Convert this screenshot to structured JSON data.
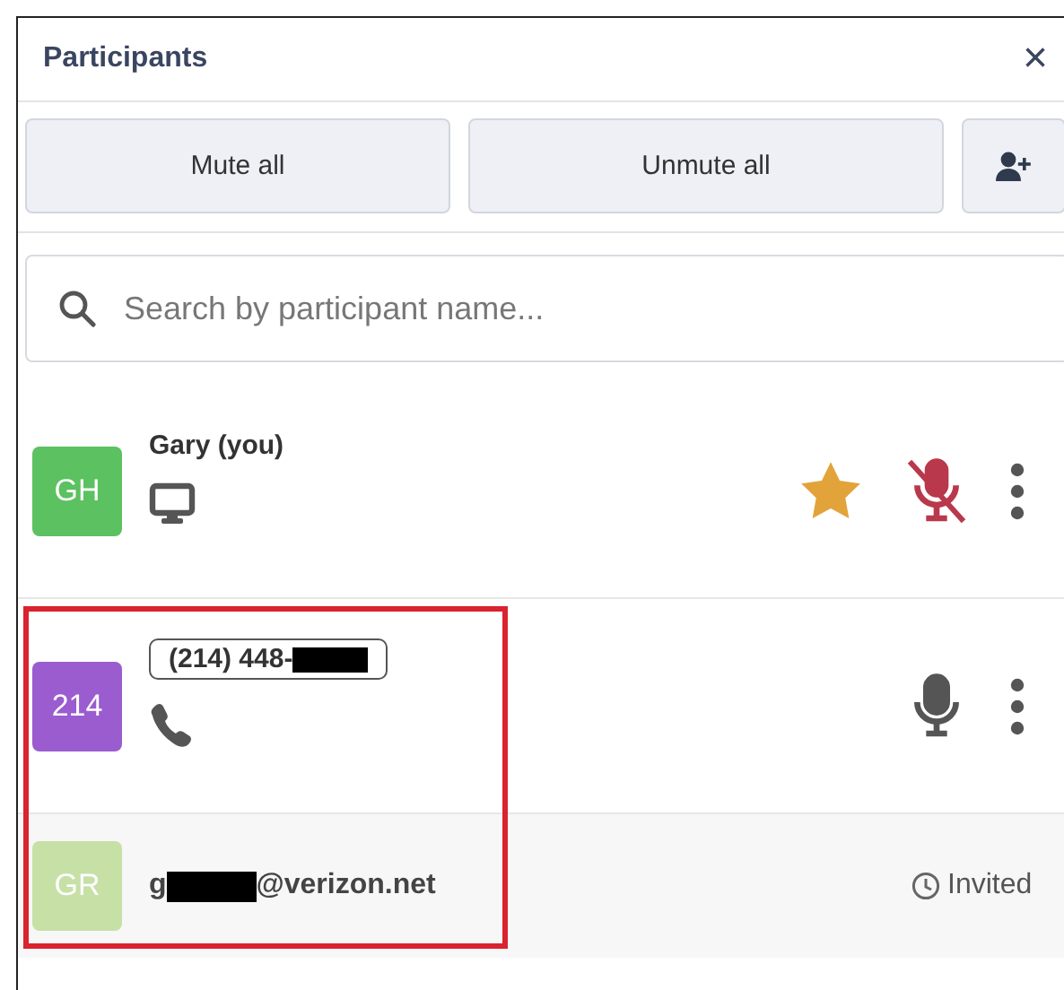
{
  "panel": {
    "title": "Participants",
    "close": "×"
  },
  "actions": [
    {
      "kind": "text",
      "label": "Mute all"
    },
    {
      "kind": "text",
      "label": "Unmute all"
    },
    {
      "kind": "add-person"
    }
  ],
  "search": {
    "placeholder": "Search by participant name..."
  },
  "participants": [
    {
      "kind": "joined",
      "initials": "GH",
      "color": "#5cc160",
      "outlined": false,
      "name": [
        {
          "kind": "text",
          "text": "Gary (you)"
        }
      ],
      "device": {
        "kind": "computer"
      },
      "starred": true,
      "muted": true
    },
    {
      "kind": "joined",
      "initials": "214",
      "color": "#9a5ccf",
      "outlined": true,
      "name": [
        {
          "kind": "text",
          "text": "(214) 448-"
        },
        {
          "kind": "redaction"
        }
      ],
      "device": {
        "kind": "phone"
      },
      "starred": false,
      "muted": false
    },
    {
      "kind": "invited",
      "initials": "GR",
      "color": "#c6e0a6",
      "name": [
        {
          "kind": "text",
          "text": "g"
        },
        {
          "kind": "redaction"
        },
        {
          "kind": "text",
          "text": "@verizon.net"
        }
      ],
      "status": "Invited"
    }
  ],
  "annotation": {
    "kind": "highlight-box"
  }
}
